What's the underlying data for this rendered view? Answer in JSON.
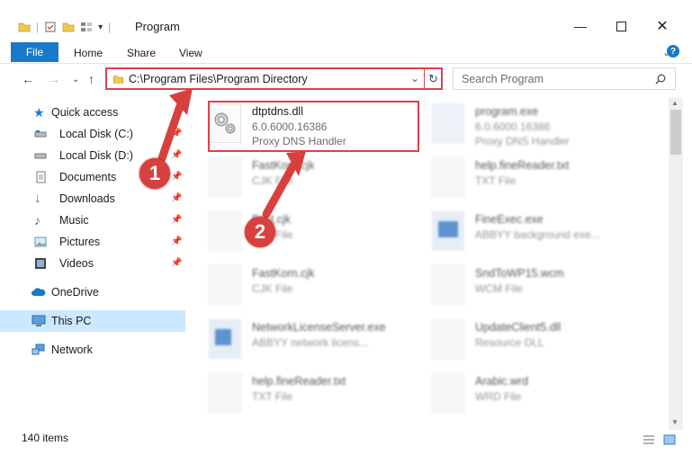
{
  "window": {
    "title": "Program"
  },
  "ribbon": {
    "file": "File",
    "home": "Home",
    "share": "Share",
    "view": "View"
  },
  "address": {
    "path": "C:\\Program Files\\Program Directory"
  },
  "search": {
    "placeholder": "Search Program"
  },
  "sidebar": {
    "items": [
      {
        "label": "Quick access"
      },
      {
        "label": "Local Disk (C:)"
      },
      {
        "label": "Local Disk (D:)"
      },
      {
        "label": "Documents"
      },
      {
        "label": "Downloads"
      },
      {
        "label": "Music"
      },
      {
        "label": "Pictures"
      },
      {
        "label": "Videos"
      },
      {
        "label": "OneDrive"
      },
      {
        "label": "This PC"
      },
      {
        "label": "Network"
      }
    ]
  },
  "files": [
    {
      "name": "dtptdns.dll",
      "line2": "6.0.6000.16386",
      "line3": "Proxy DNS Handler"
    },
    {
      "name": "program.exe",
      "line2": "6.0.6000.16386",
      "line3": "Proxy DNS Handler"
    },
    {
      "name": "FastKorn.cjk",
      "line2": "CJK File",
      "line3": ""
    },
    {
      "name": "help.fineReader.txt",
      "line2": "TXT File",
      "line3": ""
    },
    {
      "name": "Fast.cjk",
      "line2": "CJK File",
      "line3": ""
    },
    {
      "name": "FineExec.exe",
      "line2": "ABBYY background exe...",
      "line3": ""
    },
    {
      "name": "FastKorn.cjk",
      "line2": "CJK File",
      "line3": ""
    },
    {
      "name": "SndToWP15.wcm",
      "line2": "WCM File",
      "line3": ""
    },
    {
      "name": "NetworkLicenseServer.exe",
      "line2": "ABBYY network licens...",
      "line3": ""
    },
    {
      "name": "UpdateClient5.dll",
      "line2": "Resource DLL",
      "line3": ""
    },
    {
      "name": "help.fineReader.txt",
      "line2": "TXT File",
      "line3": ""
    },
    {
      "name": "Arabic.wrd",
      "line2": "WRD File",
      "line3": ""
    }
  ],
  "status": {
    "count": "140 items"
  },
  "markers": {
    "one": "1",
    "two": "2"
  },
  "colors": {
    "accent": "#1979ca",
    "highlight": "#e0404a",
    "selected": "#cce8ff"
  }
}
